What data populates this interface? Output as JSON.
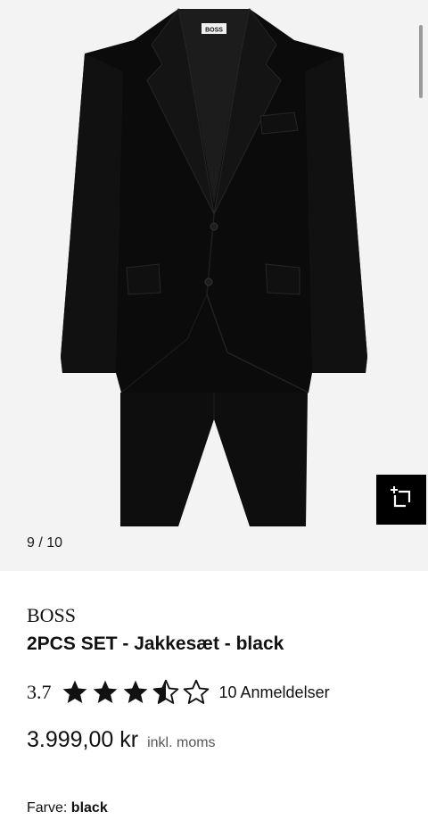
{
  "product": {
    "brand": "BOSS",
    "title": "2PCS SET - Jakkesæt - black",
    "collar_label": "BOSS"
  },
  "gallery": {
    "counter": "9 / 10",
    "find_similar_icon": "find-similar-icon",
    "background": "#f3f3f3"
  },
  "rating": {
    "value": "3.7",
    "stars": 3.5,
    "max_stars": 5,
    "reviews_label": "10 Anmeldelser"
  },
  "price": {
    "amount": "3.999,00 kr",
    "vat_note": "inkl. moms"
  },
  "color": {
    "label": "Farve:",
    "value": "black"
  },
  "colors": {
    "accent": "#000000",
    "page_bg": "#ffffff"
  }
}
